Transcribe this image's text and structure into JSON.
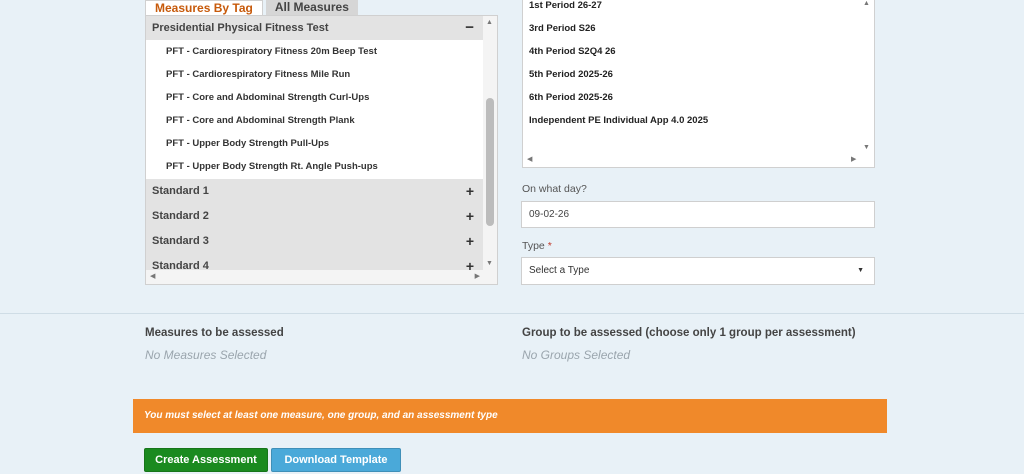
{
  "tabs": {
    "measures_by_tag": "Measures By Tag",
    "all_measures": "All Measures"
  },
  "tag_panel": {
    "open_group": {
      "title": "Presidential Physical Fitness Test",
      "toggle": "−",
      "items": [
        "PFT - Cardiorespiratory Fitness 20m Beep Test",
        "PFT - Cardiorespiratory Fitness Mile Run",
        "PFT - Core and Abdominal Strength Curl-Ups",
        "PFT - Core and Abdominal Strength Plank",
        "PFT - Upper Body Strength Pull-Ups",
        "PFT - Upper Body Strength Rt. Angle Push-ups"
      ]
    },
    "standards": [
      {
        "label": "Standard 1",
        "toggle": "+"
      },
      {
        "label": "Standard 2",
        "toggle": "+"
      },
      {
        "label": "Standard 3",
        "toggle": "+"
      },
      {
        "label": "Standard 4",
        "toggle": "+"
      }
    ]
  },
  "group_panel": {
    "items": [
      "1st Period 26-27",
      "3rd Period S26",
      "4th Period S2Q4 26",
      "5th Period 2025-26",
      "6th Period 2025-26",
      "Independent PE Individual App 4.0 2025"
    ]
  },
  "date_field": {
    "label": "On what day?",
    "value": "09-02-26"
  },
  "type_field": {
    "label": "Type",
    "required_mark": "*",
    "selected": "Select a Type"
  },
  "measures_section": {
    "title": "Measures to be assessed",
    "empty": "No Measures Selected"
  },
  "groups_section": {
    "title": "Group to be assessed (choose only 1 group per assessment)",
    "empty": "No Groups Selected"
  },
  "alert": {
    "message": "You must select at least one measure, one group, and an assessment type"
  },
  "buttons": {
    "create": "Create Assessment",
    "download": "Download Template"
  },
  "colors": {
    "active_tab_text": "#c75a0b",
    "alert_bg": "#f0892a",
    "create_button": "#1a8a1f",
    "download_button": "#4aa9d9"
  },
  "icons": {
    "scroll_up": "▲",
    "scroll_down": "▼",
    "scroll_left": "◀",
    "scroll_right": "▶",
    "select_caret": "▼"
  }
}
